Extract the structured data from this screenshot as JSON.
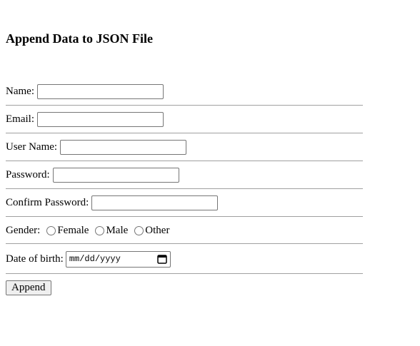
{
  "form": {
    "title": "Append Data to JSON File",
    "name_label": "Name:",
    "name_value": "",
    "email_label": "Email:",
    "email_value": "",
    "username_label": "User Name:",
    "username_value": "",
    "password_label": "Password:",
    "password_value": "",
    "confirm_label": "Confirm Password:",
    "confirm_value": "",
    "gender_label": "Gender:",
    "gender_options": [
      "Female",
      "Male",
      "Other"
    ],
    "dob_label": "Date of birth:",
    "dob_placeholder": "mm/dd/yyyy",
    "submit_label": "Append"
  },
  "icons": {
    "date_picker": "calendar-icon"
  }
}
